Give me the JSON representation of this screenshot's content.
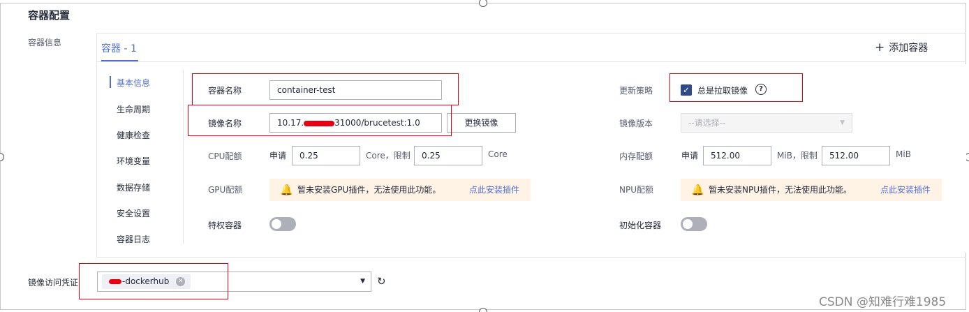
{
  "section": {
    "title": "容器配置",
    "container_info_label": "容器信息"
  },
  "tabs": {
    "active": "容器 - 1",
    "add_label": "添加容器"
  },
  "nav": [
    "基本信息",
    "生命周期",
    "健康检查",
    "环境变量",
    "数据存储",
    "安全设置",
    "容器日志"
  ],
  "basic": {
    "container_name_label": "容器名称",
    "container_name_value": "container-test",
    "image_name_label": "镜像名称",
    "image_name_prefix": "10.17.",
    "image_name_suffix": "31000/brucetest:1.0",
    "change_image_button": "更换镜像",
    "cpu_label": "CPU配额",
    "request_label": "申请",
    "cpu_request": "0.25",
    "cpu_unit_limit": "Core，限制",
    "cpu_limit": "0.25",
    "cpu_unit": "Core",
    "gpu_label": "GPU配额",
    "gpu_notice": "暂未安装GPU插件，无法使用此功能。",
    "install_link": "点此安装插件",
    "privileged_label": "特权容器"
  },
  "right": {
    "update_policy_label": "更新策略",
    "always_pull_label": "总是拉取镜像",
    "always_pull_checked": true,
    "image_version_label": "镜像版本",
    "image_version_placeholder": "--请选择--",
    "memory_label": "内存配额",
    "request_label": "申请",
    "mem_request": "512.00",
    "mem_unit_limit": "MiB，限制",
    "mem_limit": "512.00",
    "mem_unit": "MiB",
    "npu_label": "NPU配额",
    "npu_notice": "暂未安装NPU插件，无法使用此功能。",
    "install_link": "点此安装插件",
    "init_container_label": "初始化容器"
  },
  "credentials": {
    "label": "镜像访问凭证",
    "tag": "-dockerhub"
  },
  "watermark": "CSDN @知难行难1985",
  "colors": {
    "accent": "#526ecc",
    "highlight_box": "#e60012",
    "notice_bg": "#fff3e6"
  },
  "icons": {
    "plus": "plus-icon",
    "bell": "bell-icon",
    "help": "help-circle-icon",
    "refresh": "refresh-icon",
    "caret": "caret-down-icon",
    "check": "check-icon",
    "clear": "clear-circle-icon"
  }
}
